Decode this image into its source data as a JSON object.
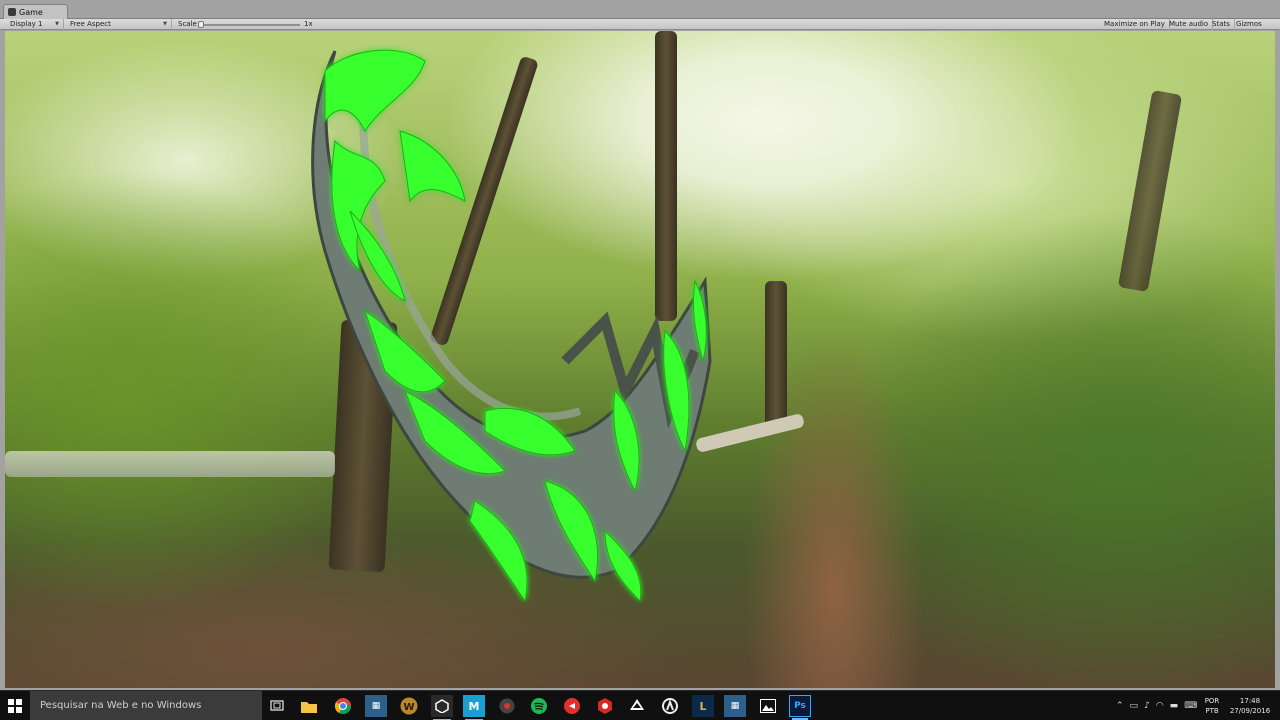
{
  "window": {
    "tab_label": "Game"
  },
  "toolbar": {
    "display": "Display 1",
    "aspect": "Free Aspect",
    "scale_label": "Scale",
    "scale_value": "1x",
    "scale_fraction": 0.0,
    "maximize_on_play": "Maximize on Play",
    "mute_audio": "Mute audio",
    "stats": "Stats",
    "gizmos": "Gizmos"
  },
  "taskbar": {
    "search_placeholder": "Pesquisar na Web e no Windows",
    "apps": [
      {
        "name": "task-view",
        "icon": "task-view-icon"
      },
      {
        "name": "file-explorer",
        "icon": "folder-icon"
      },
      {
        "name": "chrome",
        "icon": "chrome-icon"
      },
      {
        "name": "visual-studio-a",
        "icon": "visual-studio-icon"
      },
      {
        "name": "wow",
        "icon": "wow-icon"
      },
      {
        "name": "unity",
        "icon": "unity-icon"
      },
      {
        "name": "m-app",
        "icon": "m-app-icon"
      },
      {
        "name": "media-app",
        "icon": "media-app-icon"
      },
      {
        "name": "spotify",
        "icon": "spotify-icon"
      },
      {
        "name": "red-app-a",
        "icon": "red-app-icon"
      },
      {
        "name": "red-app-b",
        "icon": "red-app-icon"
      },
      {
        "name": "inkscape",
        "icon": "inkscape-icon"
      },
      {
        "name": "overwatch",
        "icon": "overwatch-icon"
      },
      {
        "name": "league",
        "icon": "league-icon"
      },
      {
        "name": "visual-studio-b",
        "icon": "visual-studio-icon"
      },
      {
        "name": "photos",
        "icon": "photos-icon"
      },
      {
        "name": "photoshop",
        "icon": "photoshop-icon"
      }
    ],
    "language_line1": "POR",
    "language_line2": "PTB",
    "time": "17:48",
    "date": "27/09/2016"
  },
  "colors": {
    "neon_green": "#39ff2e",
    "blade_grey": "#6e7b72",
    "taskbar": "#101010",
    "search_box": "#3b3b3b",
    "unity_toolbar": "#c8c8c8"
  }
}
